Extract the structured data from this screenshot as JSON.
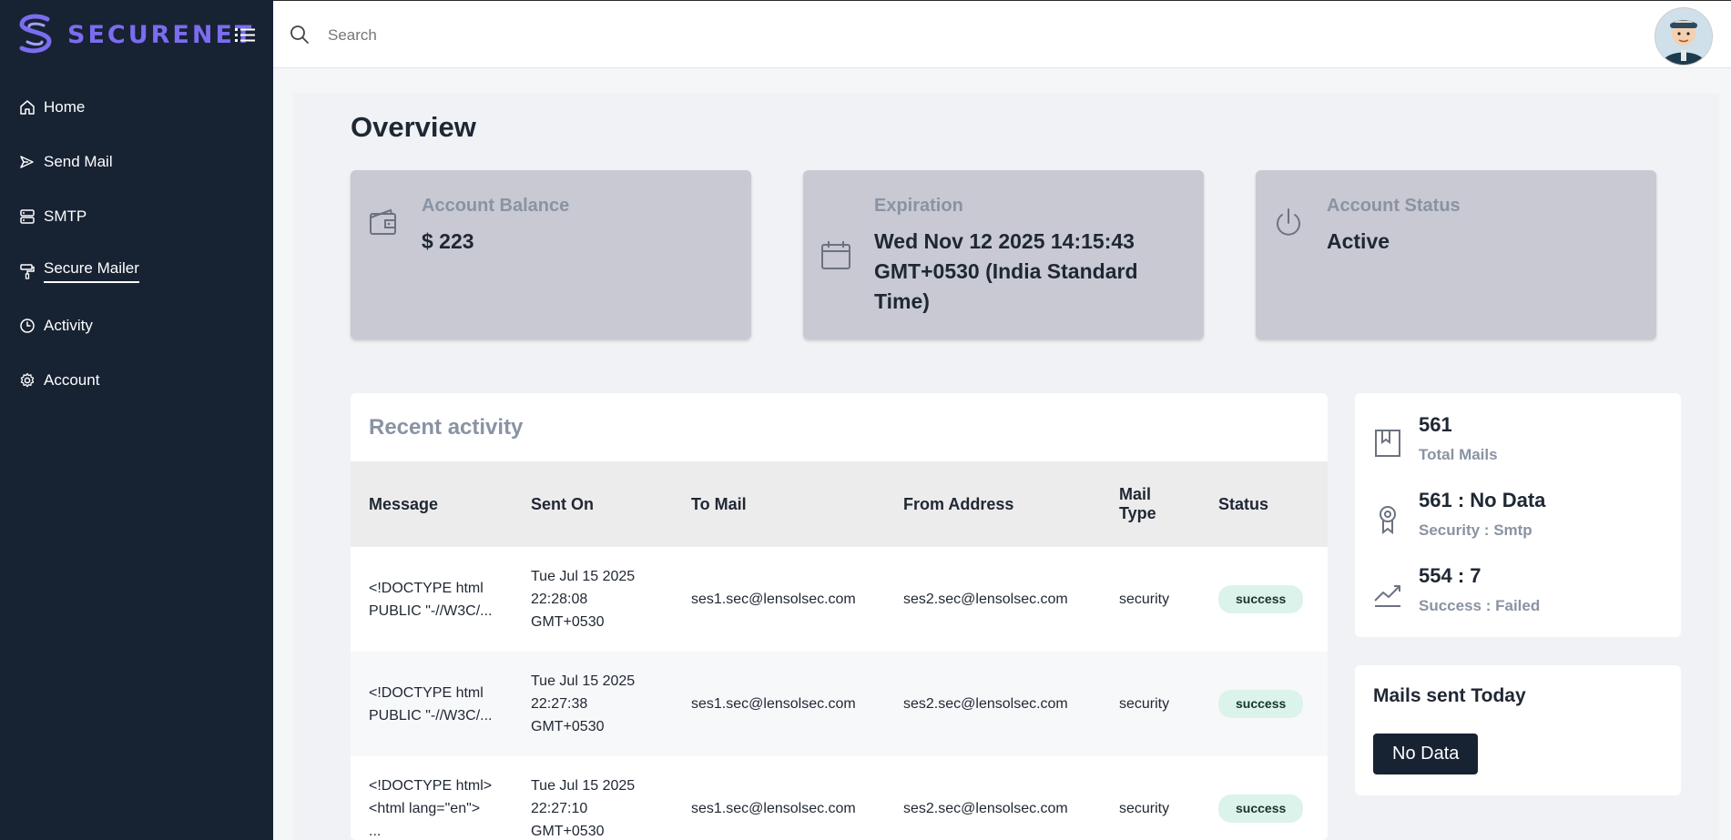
{
  "brand": {
    "name": "SECURENET"
  },
  "sidebar": {
    "items": [
      {
        "label": "Home",
        "icon": "home-icon"
      },
      {
        "label": "Send Mail",
        "icon": "send-icon"
      },
      {
        "label": "SMTP",
        "icon": "server-icon"
      },
      {
        "label": "Secure Mailer",
        "icon": "paint-roller-icon",
        "active": true
      },
      {
        "label": "Activity",
        "icon": "clock-icon"
      },
      {
        "label": "Account",
        "icon": "gear-icon"
      }
    ]
  },
  "search": {
    "placeholder": "Search",
    "value": ""
  },
  "page": {
    "title": "Overview"
  },
  "cards": [
    {
      "label": "Account Balance",
      "value": "$ 223",
      "icon": "wallet-icon"
    },
    {
      "label": "Expiration",
      "value": "Wed Nov 12 2025 14:15:43 GMT+0530 (India Standard Time)",
      "icon": "calendar-icon"
    },
    {
      "label": "Account Status",
      "value": "Active",
      "icon": "power-icon"
    }
  ],
  "activity": {
    "title": "Recent activity",
    "columns": [
      "Message",
      "Sent On",
      "To Mail",
      "From Address",
      "Mail Type",
      "Status"
    ],
    "rows": [
      {
        "message": "<!DOCTYPE html PUBLIC \"-//W3C/...",
        "sent_on": "Tue Jul 15 2025 22:28:08 GMT+0530",
        "to": "ses1.sec@lensolsec.com",
        "from": "ses2.sec@lensolsec.com",
        "type": "security",
        "status": "success"
      },
      {
        "message": "<!DOCTYPE html PUBLIC \"-//W3C/...",
        "sent_on": "Tue Jul 15 2025 22:27:38 GMT+0530",
        "to": "ses1.sec@lensolsec.com",
        "from": "ses2.sec@lensolsec.com",
        "type": "security",
        "status": "success"
      },
      {
        "message": "<!DOCTYPE html> <html lang=\"en\"> ...",
        "sent_on": "Tue Jul 15 2025 22:27:10 GMT+0530",
        "to": "ses1.sec@lensolsec.com",
        "from": "ses2.sec@lensolsec.com",
        "type": "security",
        "status": "success"
      }
    ]
  },
  "stats": [
    {
      "value": "561",
      "label": "Total Mails",
      "icon": "bookmark-icon"
    },
    {
      "value": "561 : No Data",
      "label": "Security : Smtp",
      "icon": "award-icon"
    },
    {
      "value": "554 : 7",
      "label": "Success : Failed",
      "icon": "trend-icon"
    }
  ],
  "today": {
    "title": "Mails sent Today",
    "value": "No Data"
  },
  "colors": {
    "sidebar": "#172233",
    "brand": "#7b6cf0",
    "card": "#c8c9d2",
    "badge": "#dcf3ec"
  }
}
